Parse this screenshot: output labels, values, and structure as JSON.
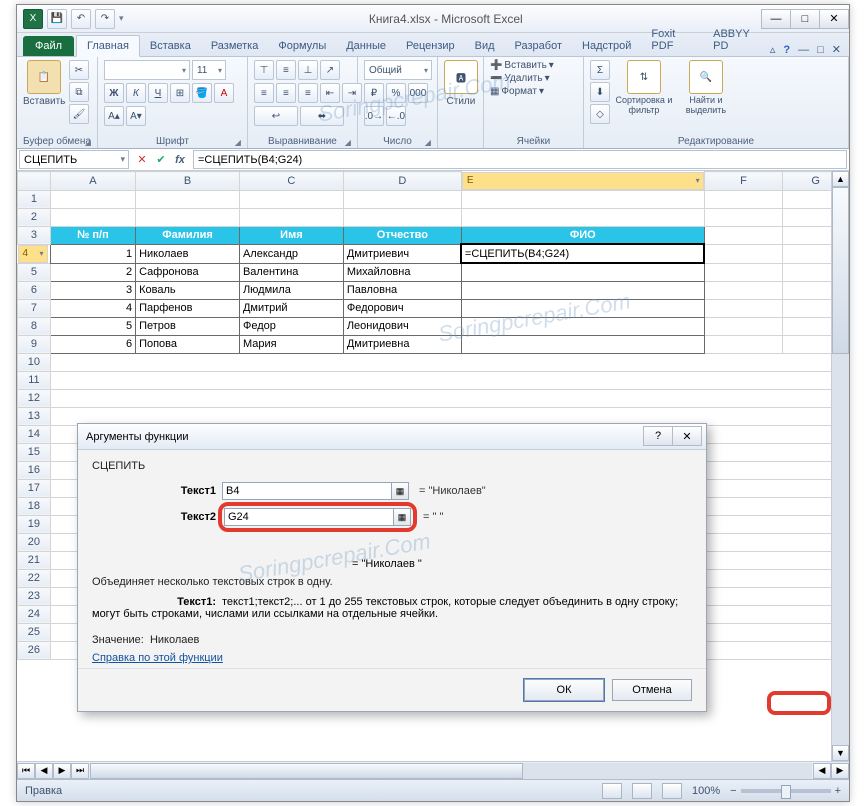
{
  "window": {
    "title": "Книга4.xlsx - Microsoft Excel"
  },
  "tabs": {
    "file": "Файл",
    "items": [
      "Главная",
      "Вставка",
      "Разметка",
      "Формулы",
      "Данные",
      "Рецензир",
      "Вид",
      "Разработ",
      "Надстрой",
      "Foxit PDF",
      "ABBYY PD"
    ],
    "active_index": 0
  },
  "ribbon": {
    "clipboard": {
      "label": "Буфер обмена",
      "paste": "Вставить"
    },
    "font": {
      "label": "Шрифт",
      "size": "11"
    },
    "alignment": {
      "label": "Выравнивание"
    },
    "number": {
      "label": "Число",
      "format": "Общий"
    },
    "styles": {
      "label": "Стили",
      "btn": "Стили"
    },
    "cells": {
      "label": "Ячейки",
      "insert": "Вставить",
      "delete": "Удалить",
      "format": "Формат"
    },
    "editing": {
      "label": "Редактирование",
      "sort": "Сортировка и фильтр",
      "find": "Найти и выделить"
    }
  },
  "formula_bar": {
    "namebox": "СЦЕПИТЬ",
    "formula": "=СЦЕПИТЬ(B4;G24)"
  },
  "columns": [
    "A",
    "B",
    "C",
    "D",
    "E",
    "F",
    "G"
  ],
  "active_column_index": 4,
  "table": {
    "headers": {
      "num": "№ п/п",
      "last": "Фамилия",
      "first": "Имя",
      "patr": "Отчество",
      "fio": "ФИО"
    },
    "rows": [
      {
        "n": "1",
        "last": "Николаев",
        "first": "Александр",
        "patr": "Дмитриевич",
        "fio": "=СЦЕПИТЬ(B4;G24)"
      },
      {
        "n": "2",
        "last": "Сафронова",
        "first": "Валентина",
        "patr": "Михайловна",
        "fio": ""
      },
      {
        "n": "3",
        "last": "Коваль",
        "first": "Людмила",
        "patr": "Павловна",
        "fio": ""
      },
      {
        "n": "4",
        "last": "Парфенов",
        "first": "Дмитрий",
        "patr": "Федорович",
        "fio": ""
      },
      {
        "n": "5",
        "last": "Петров",
        "first": "Федор",
        "patr": "Леонидович",
        "fio": ""
      },
      {
        "n": "6",
        "last": "Попова",
        "first": "Мария",
        "patr": "Дмитриевна",
        "fio": ""
      }
    ]
  },
  "row_numbers": [
    1,
    2,
    3,
    4,
    5,
    6,
    7,
    8,
    9,
    10,
    11,
    12,
    13,
    14,
    15,
    16,
    17,
    18,
    19,
    20,
    21,
    22,
    23,
    24,
    25,
    26
  ],
  "active_row": 4,
  "dialog": {
    "title": "Аргументы функции",
    "func": "СЦЕПИТЬ",
    "args": [
      {
        "label": "Текст1",
        "value": "B4",
        "result": "= \"Николаев\""
      },
      {
        "label": "Текст2",
        "value": "G24",
        "result": "= \" \""
      }
    ],
    "preview": "= \"Николаев \"",
    "desc": "Объединяет несколько текстовых строк в одну.",
    "help_label": "Текст1:",
    "help_text": "текст1;текст2;... от 1 до 255 текстовых строк, которые следует объединить в одну строку; могут быть строками, числами или ссылками на отдельные ячейки.",
    "value_label": "Значение:",
    "value": "Николаев",
    "link": "Справка по этой функции",
    "ok": "ОК",
    "cancel": "Отмена"
  },
  "status": {
    "mode": "Правка",
    "zoom": "100%"
  },
  "watermark": "Soringpcrepair.Com"
}
